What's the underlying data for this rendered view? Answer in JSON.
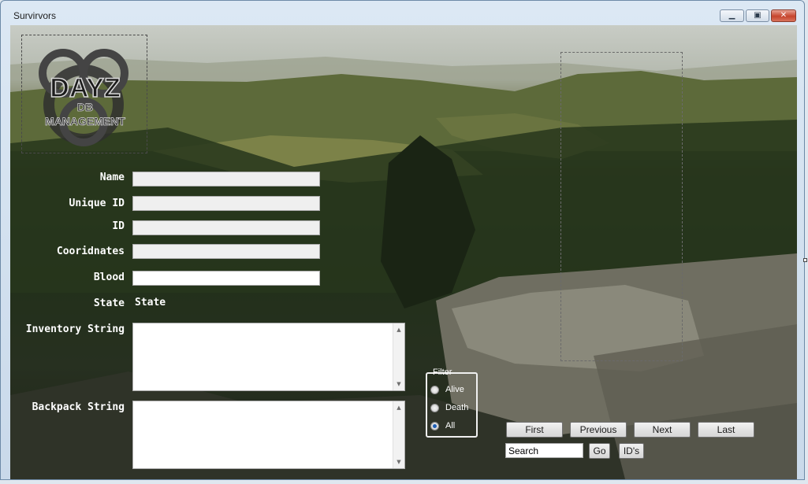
{
  "window": {
    "title": "Survirvors",
    "minimize_icon": "minimize-icon",
    "maximize_icon": "restore-icon",
    "close_icon": "close-icon"
  },
  "logo": {
    "line1": "DAYZ",
    "line2": "DB",
    "line3": "MANAGEMENT"
  },
  "form": {
    "name_label": "Name",
    "unique_id_label": "Unique ID",
    "id_label": "ID",
    "coordinates_label": "Cooridnates",
    "blood_label": "Blood",
    "state_label": "State",
    "state_value": "State",
    "inventory_label": "Inventory String",
    "backpack_label": "Backpack String",
    "name_value": "",
    "unique_id_value": "",
    "id_value": "",
    "coordinates_value": "",
    "blood_value": "",
    "inventory_value": "",
    "backpack_value": ""
  },
  "filter": {
    "legend": "Filter",
    "options": [
      "Alive",
      "Death",
      "All"
    ],
    "selected": "All"
  },
  "navigation": {
    "first": "First",
    "previous": "Previous",
    "next": "Next",
    "last": "Last"
  },
  "search": {
    "value": "Search",
    "go_label": "Go",
    "ids_label": "ID's"
  }
}
